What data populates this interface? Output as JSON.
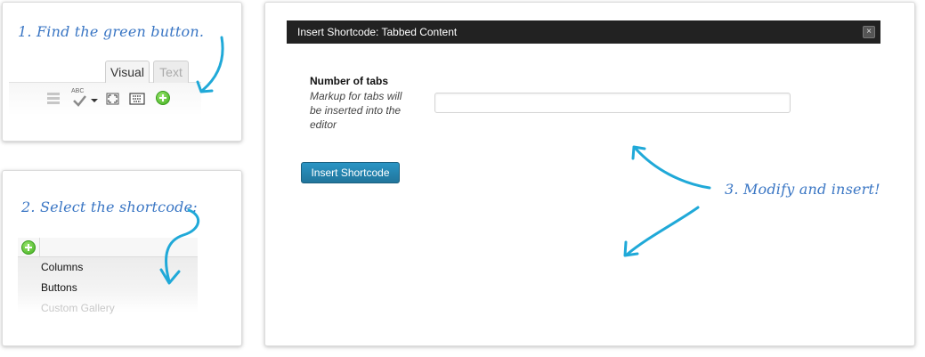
{
  "step1": {
    "caption": "1. Find the green button.",
    "tabs": [
      "Visual",
      "Text"
    ],
    "toolbar_icons": [
      "toolbar-toggle-icon",
      "spellcheck-icon",
      "dropdown-arrow-icon",
      "fullscreen-icon",
      "keyboard-icon",
      "add-shortcode-icon"
    ],
    "spellcheck_label": "ABC"
  },
  "step2": {
    "caption": "2. Select the shortcode:",
    "menu_items": [
      "Columns",
      "Buttons",
      "Custom Gallery"
    ]
  },
  "step3": {
    "caption": "3. Modify and insert!",
    "dialog": {
      "title": "Insert Shortcode: Tabbed Content",
      "close_glyph": "×",
      "field_label": "Number of tabs",
      "field_help": "Markup for tabs will be inserted into the editor",
      "field_value": "",
      "button_label": "Insert Shortcode"
    }
  },
  "colors": {
    "accent_script": "#3a76c4",
    "arrow": "#20a9d8",
    "dialog_bar": "#222222",
    "button": "#21759b",
    "plus_green": "#3fae1c"
  }
}
